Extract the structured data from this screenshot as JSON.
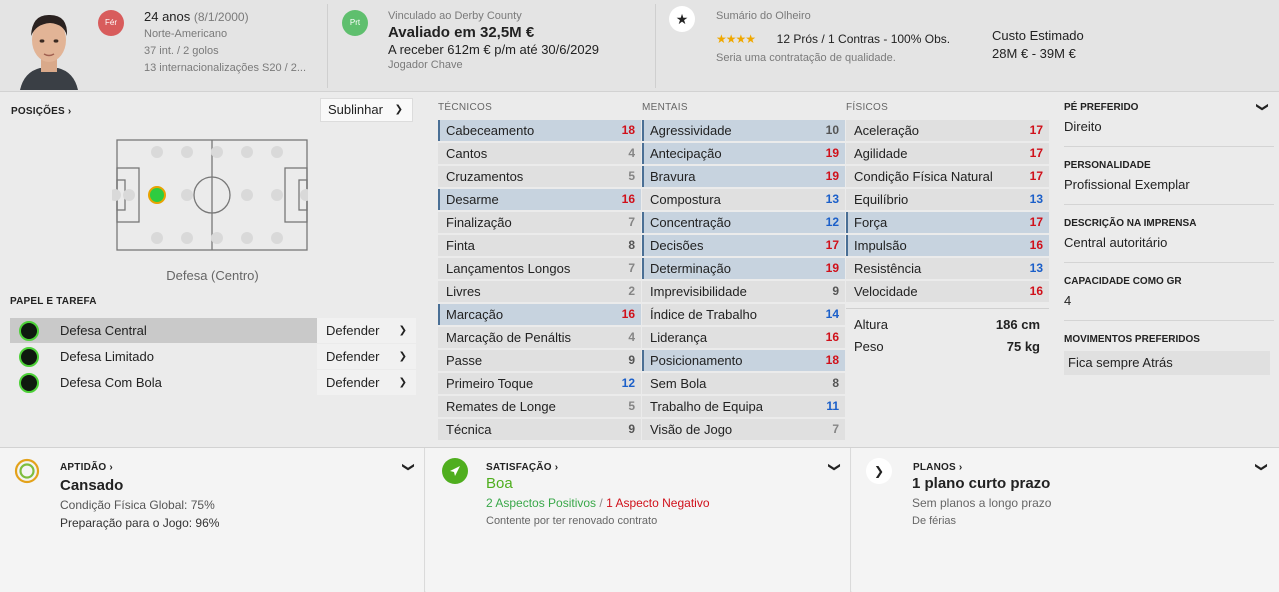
{
  "header": {
    "age": "24 anos",
    "dob": "(8/1/2000)",
    "nationality": "Norte-Americano",
    "caps": "37 int. / 2 golos",
    "youth_caps": "13 internacionalizações S20 / 2...",
    "foot_badge": "Fér",
    "club_badge": "Prt",
    "contract_club": "Vinculado ao Derby County",
    "value": "Avaliado em 32,5M €",
    "wage": "A receber 612m € p/m até 30/6/2029",
    "squad_status": "Jogador Chave",
    "scout_title": "Sumário do Olheiro",
    "scout_stars": "★★★★",
    "scout_summary": "12 Prós / 1 Contras - 100% Obs.",
    "scout_note": "Seria uma contratação de qualidade.",
    "cost_label": "Custo Estimado",
    "cost_value": "28M € - 39M €"
  },
  "positions": {
    "title": "POSIÇÕES",
    "dropdown": "Sublinhar",
    "label": "Defesa (Centro)"
  },
  "roles": {
    "title": "PAPEL E TAREFA",
    "items": [
      {
        "name": "Defesa Central",
        "duty": "Defender"
      },
      {
        "name": "Defesa Limitado",
        "duty": "Defender"
      },
      {
        "name": "Defesa Com Bola",
        "duty": "Defender"
      }
    ]
  },
  "attributes": {
    "technical_title": "TÉCNICOS",
    "mental_title": "MENTAIS",
    "physical_title": "FÍSICOS",
    "technical": [
      {
        "name": "Cabeceamento",
        "value": "18",
        "hl": true
      },
      {
        "name": "Cantos",
        "value": "4",
        "hl": false
      },
      {
        "name": "Cruzamentos",
        "value": "5",
        "hl": false
      },
      {
        "name": "Desarme",
        "value": "16",
        "hl": true
      },
      {
        "name": "Finalização",
        "value": "7",
        "hl": false
      },
      {
        "name": "Finta",
        "value": "8",
        "hl": false
      },
      {
        "name": "Lançamentos Longos",
        "value": "7",
        "hl": false
      },
      {
        "name": "Livres",
        "value": "2",
        "hl": false
      },
      {
        "name": "Marcação",
        "value": "16",
        "hl": true
      },
      {
        "name": "Marcação de Penáltis",
        "value": "4",
        "hl": false
      },
      {
        "name": "Passe",
        "value": "9",
        "hl": false
      },
      {
        "name": "Primeiro Toque",
        "value": "12",
        "hl": false
      },
      {
        "name": "Remates de Longe",
        "value": "5",
        "hl": false
      },
      {
        "name": "Técnica",
        "value": "9",
        "hl": false
      }
    ],
    "mental": [
      {
        "name": "Agressividade",
        "value": "10",
        "hl": true
      },
      {
        "name": "Antecipação",
        "value": "19",
        "hl": true
      },
      {
        "name": "Bravura",
        "value": "19",
        "hl": true
      },
      {
        "name": "Compostura",
        "value": "13",
        "hl": false
      },
      {
        "name": "Concentração",
        "value": "12",
        "hl": true
      },
      {
        "name": "Decisões",
        "value": "17",
        "hl": true
      },
      {
        "name": "Determinação",
        "value": "19",
        "hl": true
      },
      {
        "name": "Imprevisibilidade",
        "value": "9",
        "hl": false
      },
      {
        "name": "Índice de Trabalho",
        "value": "14",
        "hl": false
      },
      {
        "name": "Liderança",
        "value": "16",
        "hl": false
      },
      {
        "name": "Posicionamento",
        "value": "18",
        "hl": true
      },
      {
        "name": "Sem Bola",
        "value": "8",
        "hl": false
      },
      {
        "name": "Trabalho de Equipa",
        "value": "11",
        "hl": false
      },
      {
        "name": "Visão de Jogo",
        "value": "7",
        "hl": false
      }
    ],
    "physical": [
      {
        "name": "Aceleração",
        "value": "17",
        "hl": false
      },
      {
        "name": "Agilidade",
        "value": "17",
        "hl": false
      },
      {
        "name": "Condição Física Natural",
        "value": "17",
        "hl": false
      },
      {
        "name": "Equilíbrio",
        "value": "13",
        "hl": false
      },
      {
        "name": "Força",
        "value": "17",
        "hl": true
      },
      {
        "name": "Impulsão",
        "value": "16",
        "hl": true
      },
      {
        "name": "Resistência",
        "value": "13",
        "hl": false
      },
      {
        "name": "Velocidade",
        "value": "16",
        "hl": false
      }
    ],
    "height_label": "Altura",
    "height_value": "186 cm",
    "weight_label": "Peso",
    "weight_value": "75 kg"
  },
  "info": {
    "foot_title": "PÉ PREFERIDO",
    "foot_value": "Direito",
    "personality_title": "PERSONALIDADE",
    "personality_value": "Profissional Exemplar",
    "media_title": "DESCRIÇÃO NA IMPRENSA",
    "media_value": "Central autoritário",
    "gk_title": "CAPACIDADE COMO GR",
    "gk_value": "4",
    "moves_title": "MOVIMENTOS PREFERIDOS",
    "moves_value": "Fica sempre Atrás"
  },
  "fitness": {
    "title": "APTIDÃO",
    "status": "Cansado",
    "line1": "Condição Física Global: 75%",
    "line2": "Preparação para o Jogo: 96%"
  },
  "happiness": {
    "title": "SATISFAÇÃO",
    "status": "Boa",
    "positive": "2 Aspectos Positivos",
    "separator": "/",
    "negative": "1 Aspecto Negativo",
    "note": "Contente por ter renovado contrato"
  },
  "plans": {
    "title": "PLANOS",
    "status": "1 plano curto prazo",
    "line1": "Sem planos a longo prazo",
    "line2": "De férias"
  },
  "colors": {
    "red": "#d0101a",
    "blue": "#1b5fc9",
    "highlight": "#c7d3df",
    "happy_green": "#4fae1e"
  }
}
